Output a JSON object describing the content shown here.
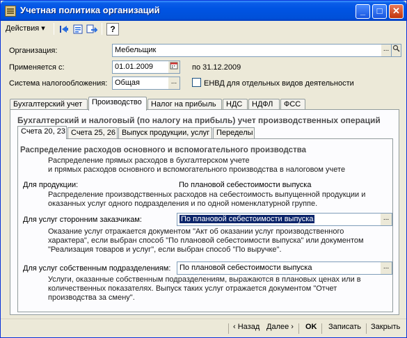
{
  "window": {
    "title": "Учетная политика организаций",
    "minimize": "_",
    "maximize": "□",
    "close": "✕"
  },
  "toolbar": {
    "actions_label": "Действия ▾",
    "help_label": "?"
  },
  "form": {
    "org_label": "Организация:",
    "org_value": "Мебельщик",
    "org_button": "...",
    "applies_label": "Применяется с:",
    "date_value": "01.01.2009",
    "date_to": "по 31.12.2009",
    "tax_label": "Система налогообложения:",
    "tax_value": "Общая",
    "tax_button": "...",
    "envd_label": "ЕНВД для отдельных видов деятельности"
  },
  "tabs": [
    "Бухгалтерский учет",
    "Производство",
    "Налог на прибыль",
    "НДС",
    "НДФЛ",
    "ФСС"
  ],
  "panel": {
    "title": "Бухгалтерский и налоговый (по налогу на прибыль) учет производственных операций",
    "subtabs": [
      "Счета 20, 23",
      "Счета 25, 26",
      "Выпуск продукции, услуг",
      "Переделы"
    ],
    "section_title": "Распределение расходов основного и вспомогательного производства",
    "desc1a": "Распределение прямых расходов в бухгалтерском учете",
    "desc1b": "и прямых расходов основного и вспомогательного производства в налоговом учете",
    "products_label": "Для продукции:",
    "products_value": "По плановой себестоимости выпуска",
    "desc2a": "Распределение производственных расходов на себестоимость выпущенной продукции и",
    "desc2b": "оказанных услуг одного подразделения и по одной номенклатурной группе.",
    "external_label": "Для услуг сторонним заказчикам:",
    "external_value": "По плановой себестоимости выпуска",
    "desc3a": "Оказание услуг отражается документом \"Акт об оказании услуг производственного",
    "desc3b": "характера\", если выбран способ \"По плановой себестоимости выпуска\" или документом",
    "desc3c": "\"Реализация товаров и услуг\", если выбран способ \"По выручке\".",
    "own_label": "Для услуг собственным подразделениям:",
    "own_value": "По плановой себестоимости выпуска",
    "desc4a": "Услуги, оказанные собственным подразделениям, выражаются в плановых ценах или в",
    "desc4b": "количественных показателях. Выпуск таких услуг отражается документом \"Отчет",
    "desc4c": "производства за смену\".",
    "select_button": "..."
  },
  "footer": {
    "back": "‹ Назад",
    "next": "Далее ›",
    "ok": "OK",
    "save": "Записать",
    "close": "Закрыть"
  },
  "colors": {
    "title_bar": "#0054e3",
    "face": "#ece9d8",
    "selection": "#0a246a"
  }
}
